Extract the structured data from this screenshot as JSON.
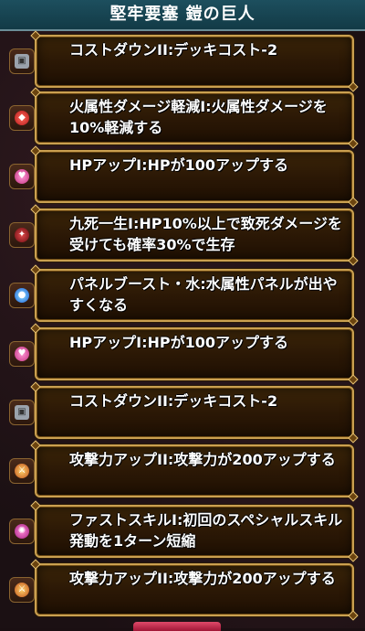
{
  "header": {
    "title": "堅牢要塞 鎧の巨人"
  },
  "abilities": [
    {
      "icon": "cost-down-icon",
      "text": "コストダウンII:デッキコスト-2"
    },
    {
      "icon": "fire-shield-icon",
      "text": "火属性ダメージ軽減I:火属性ダメージを10%軽減する"
    },
    {
      "icon": "heart-icon",
      "text": "HPアップI:HPが100アップする"
    },
    {
      "icon": "death-resist-icon",
      "text": "九死一生I:HP10%以上で致死ダメージを受けても確率30%で生存"
    },
    {
      "icon": "water-orb-icon",
      "text": "パネルブースト・水:水属性パネルが出やすくなる"
    },
    {
      "icon": "heart-icon",
      "text": "HPアップI:HPが100アップする"
    },
    {
      "icon": "cost-down-icon",
      "text": "コストダウンII:デッキコスト-2"
    },
    {
      "icon": "attack-up-icon",
      "text": "攻撃力アップII:攻撃力が200アップする"
    },
    {
      "icon": "skill-icon",
      "text": "ファストスキルI:初回のスペシャルスキル発動を1ターン短縮"
    },
    {
      "icon": "attack-up-icon",
      "text": "攻撃力アップII:攻撃力が200アップする"
    }
  ]
}
